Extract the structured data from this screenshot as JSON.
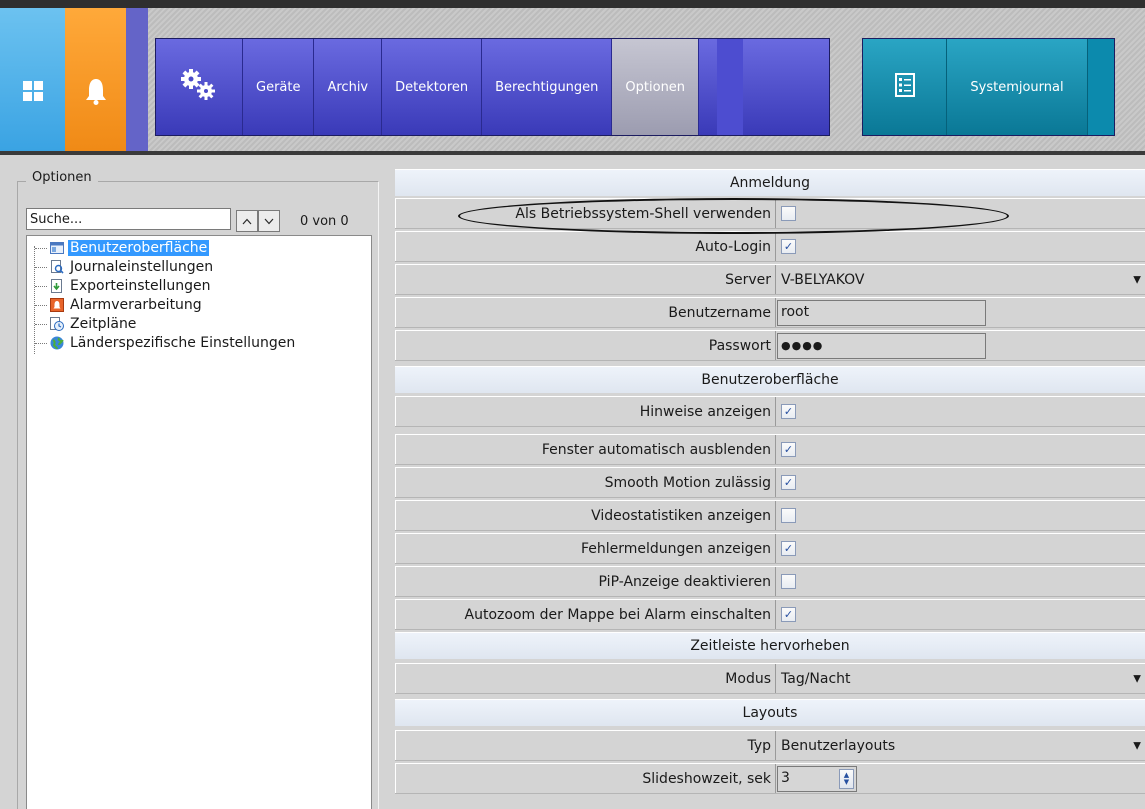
{
  "topbar": {
    "tiles": [
      {
        "name": "windows-tile",
        "icon": "windows-icon"
      },
      {
        "name": "alarm-tile",
        "icon": "bell-icon"
      }
    ],
    "main_nav": {
      "settings_icon": "gears-icon",
      "items": [
        {
          "label": "Geräte",
          "active": false
        },
        {
          "label": "Archiv",
          "active": false
        },
        {
          "label": "Detektoren",
          "active": false
        },
        {
          "label": "Berechtigungen",
          "active": false
        },
        {
          "label": "Optionen",
          "active": true
        }
      ]
    },
    "journal_nav": {
      "icon": "checklist-icon",
      "label": "Systemjournal"
    },
    "colors": {
      "windows_tile": "#3aa3e3",
      "alarm_tile": "#f08a16",
      "nav": "#4a4ac8",
      "journal": "#0a7896"
    }
  },
  "left": {
    "group_title": "Optionen",
    "search": {
      "value": "Suche..."
    },
    "counter": "0 von 0",
    "tree": [
      {
        "label": "Benutzeroberfläche",
        "icon": "ui-window-icon",
        "selected": true
      },
      {
        "label": "Journaleinstellungen",
        "icon": "journal-search-icon",
        "selected": false
      },
      {
        "label": "Exporteinstellungen",
        "icon": "export-icon",
        "selected": false
      },
      {
        "label": "Alarmverarbeitung",
        "icon": "alarm-icon",
        "selected": false
      },
      {
        "label": "Zeitpläne",
        "icon": "schedule-icon",
        "selected": false
      },
      {
        "label": "Länderspezifische Einstellungen",
        "icon": "globe-icon",
        "selected": false
      }
    ]
  },
  "right": {
    "sections": {
      "login": "Anmeldung",
      "ui": "Benutzeroberfläche",
      "timeline": "Zeitleiste hervorheben",
      "layouts": "Layouts"
    },
    "login": {
      "shell": {
        "label": "Als Betriebssystem-Shell verwenden",
        "checked": false
      },
      "autologin": {
        "label": "Auto-Login",
        "checked": true
      },
      "server": {
        "label": "Server",
        "value": "V-BELYAKOV"
      },
      "username": {
        "label": "Benutzername",
        "value": "root"
      },
      "password": {
        "label": "Passwort",
        "value": "●●●●"
      }
    },
    "ui": [
      {
        "label": "Hinweise anzeigen",
        "checked": true
      },
      {
        "label": "Fenster automatisch ausblenden",
        "checked": true
      },
      {
        "label": "Smooth Motion zulässig",
        "checked": true
      },
      {
        "label": "Videostatistiken anzeigen",
        "checked": false
      },
      {
        "label": "Fehlermeldungen anzeigen",
        "checked": true
      },
      {
        "label": "PiP-Anzeige deaktivieren",
        "checked": false
      },
      {
        "label": "Autozoom der Mappe bei Alarm einschalten",
        "checked": true
      }
    ],
    "timeline": {
      "mode": {
        "label": "Modus",
        "value": "Tag/Nacht"
      }
    },
    "layouts": {
      "type": {
        "label": "Typ",
        "value": "Benutzerlayouts"
      },
      "slideshow": {
        "label": "Slideshowzeit, sek",
        "value": "3"
      }
    }
  }
}
